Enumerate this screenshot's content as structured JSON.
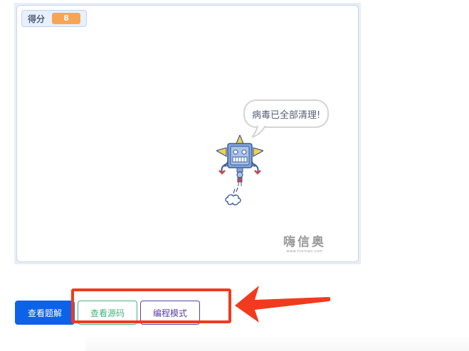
{
  "stage": {
    "score_label": "得分",
    "score_value": "8",
    "speech": "病毒已全部清理!",
    "watermark_title": "嗨信奥",
    "watermark_url": "www.hixinao.com"
  },
  "buttons": {
    "view_solution": "查看题解",
    "view_source": "查看源码",
    "programming_mode": "编程模式"
  },
  "colors": {
    "primary": "#0c63e7",
    "source_green": "#4caf7d",
    "program_purple": "#5b3fa6",
    "score_orange": "#ff8c1a",
    "annotation_red": "#f23a1e"
  },
  "icons": {
    "sprite": "robot-icon",
    "annotation": "arrow-left-icon"
  }
}
